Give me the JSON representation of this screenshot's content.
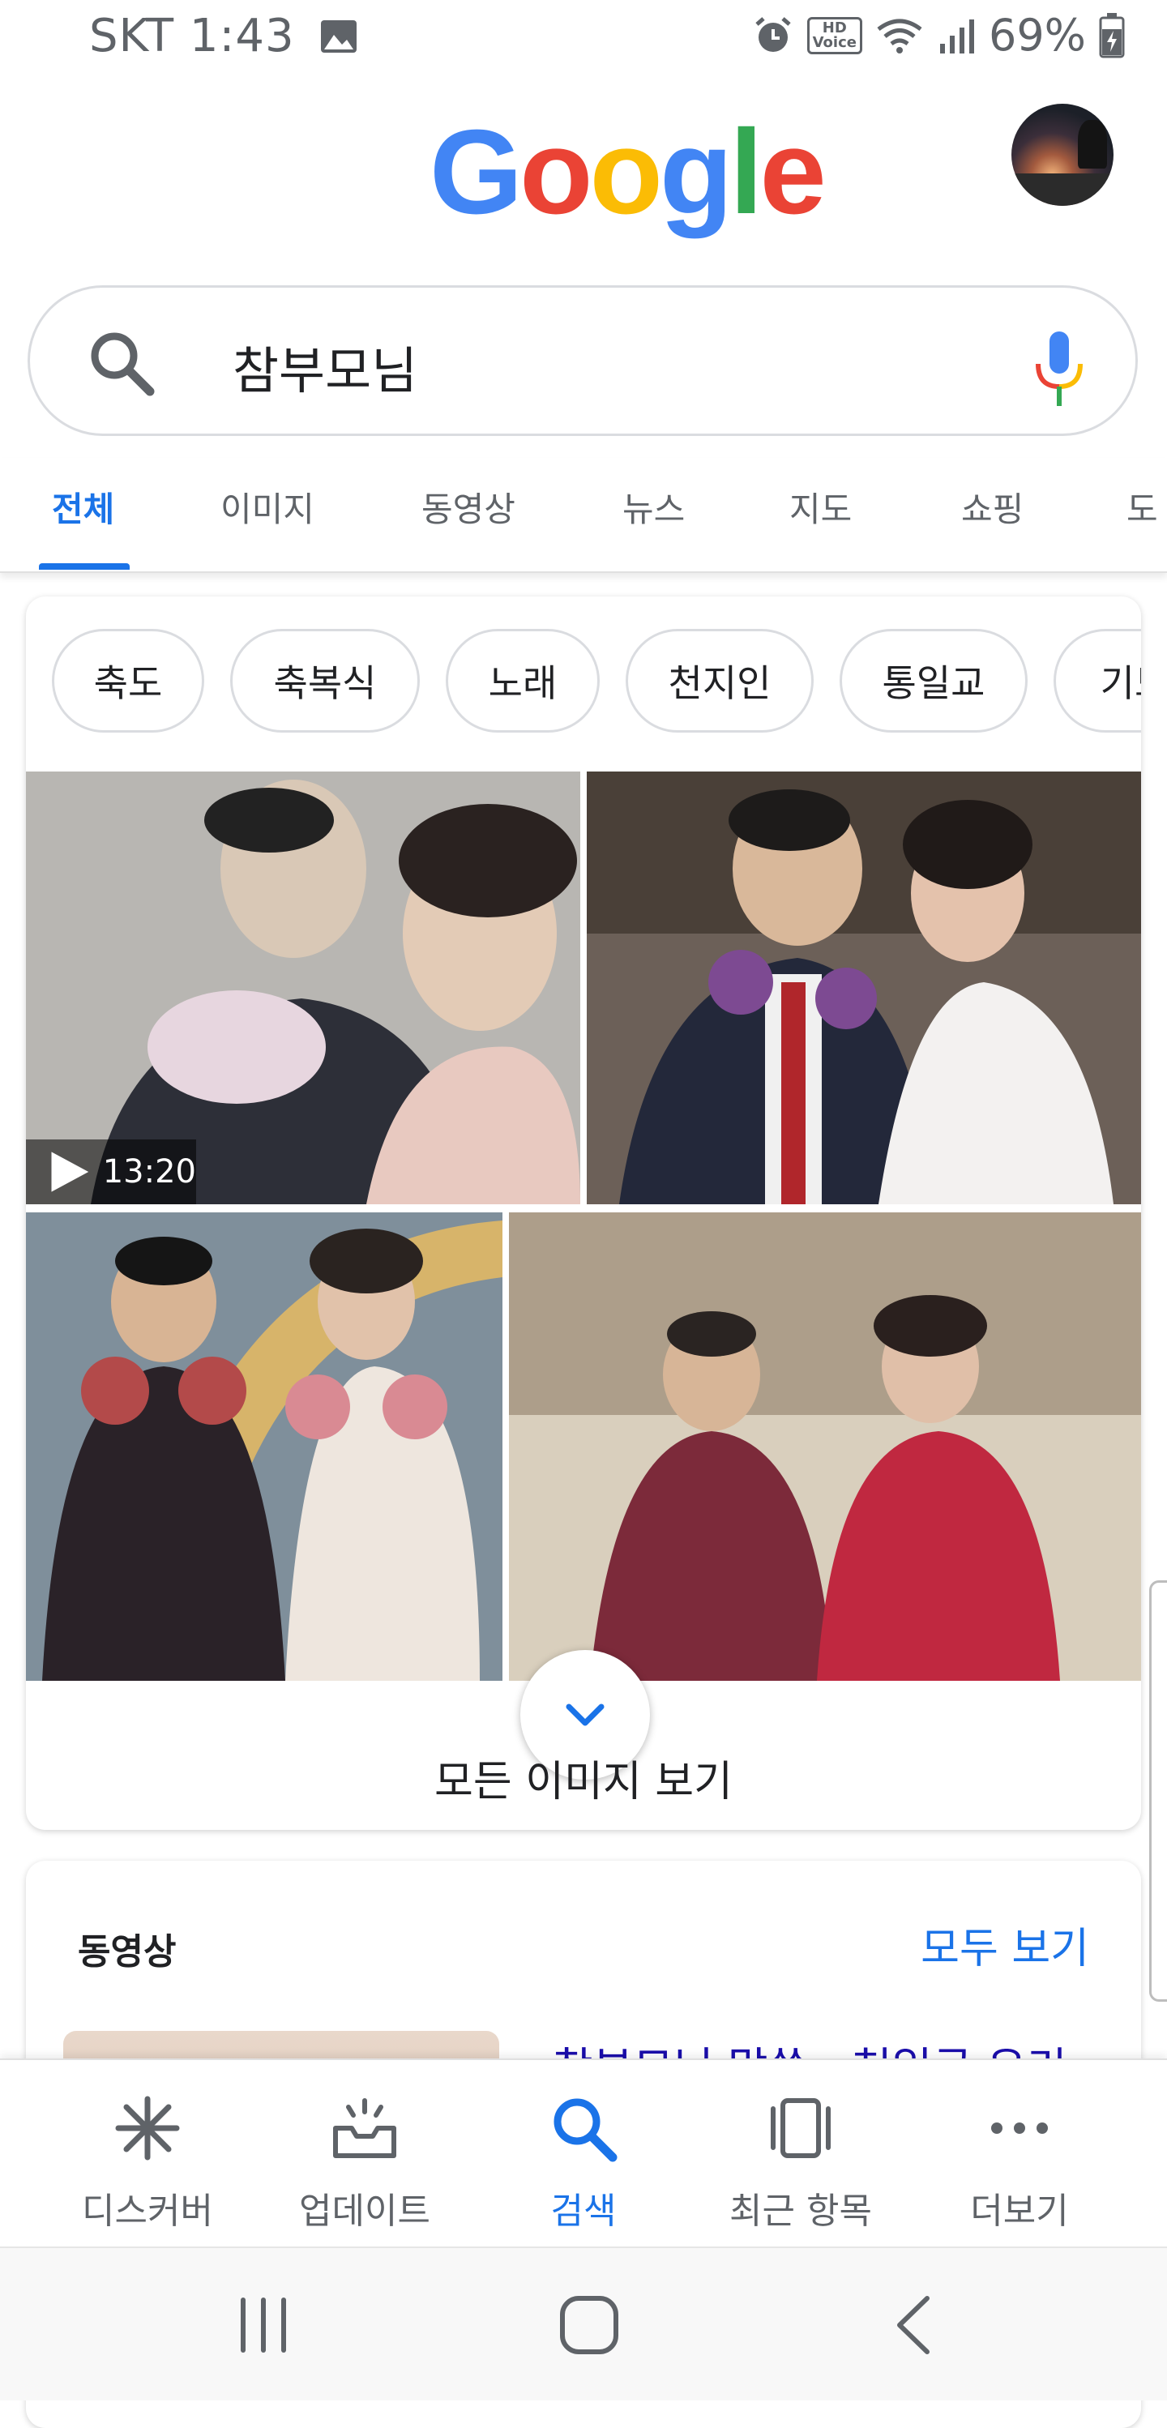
{
  "status_bar": {
    "carrier_time": "SKT 1:43",
    "hd_label_top": "HD",
    "hd_label_bottom": "Voice",
    "battery": "69%"
  },
  "header": {
    "logo_letters": [
      {
        "char": "G",
        "color": "#4285F4"
      },
      {
        "char": "o",
        "color": "#EA4335"
      },
      {
        "char": "o",
        "color": "#FBBC05"
      },
      {
        "char": "g",
        "color": "#4285F4"
      },
      {
        "char": "l",
        "color": "#34A853"
      },
      {
        "char": "e",
        "color": "#EA4335"
      }
    ]
  },
  "search": {
    "query": "참부모님"
  },
  "tabs": [
    {
      "label": "전체",
      "active": true
    },
    {
      "label": "이미지",
      "active": false
    },
    {
      "label": "동영상",
      "active": false
    },
    {
      "label": "뉴스",
      "active": false
    },
    {
      "label": "지도",
      "active": false
    },
    {
      "label": "쇼핑",
      "active": false
    },
    {
      "label": "도",
      "active": false
    }
  ],
  "image_results": {
    "chips": [
      "축도",
      "축복식",
      "노래",
      "천지인",
      "통일교",
      "기도"
    ],
    "video_duration": "13:20",
    "see_all_label": "모든 이미지 보기"
  },
  "videos_section": {
    "title": "동영상",
    "see_all": "모두 보기",
    "first_result_title": "참부모님 말씀 - 천일국 우리"
  },
  "bottom_nav": [
    {
      "label": "디스커버",
      "icon": "asterisk-discover-icon",
      "active": false
    },
    {
      "label": "업데이트",
      "icon": "tray-updates-icon",
      "active": false
    },
    {
      "label": "검색",
      "icon": "search-icon",
      "active": true
    },
    {
      "label": "최근 항목",
      "icon": "recent-cards-icon",
      "active": false
    },
    {
      "label": "더보기",
      "icon": "more-dots-icon",
      "active": false
    }
  ],
  "colors": {
    "accent_blue": "#1a73e8",
    "link": "#1a0dab",
    "text_secondary": "#5f6368"
  }
}
